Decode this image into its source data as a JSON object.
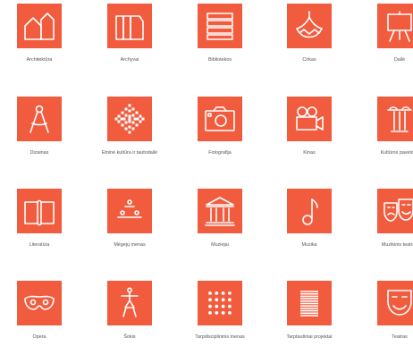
{
  "accent": "#f15c3f",
  "tiles": [
    {
      "label": "Architektūra",
      "icon": "architecture-icon"
    },
    {
      "label": "Archyvai",
      "icon": "archives-icon"
    },
    {
      "label": "Bibliotekos",
      "icon": "books-icon"
    },
    {
      "label": "Cirkas",
      "icon": "circus-tent-icon"
    },
    {
      "label": "Dailė",
      "icon": "easel-icon"
    },
    {
      "label": "Dizainas",
      "icon": "compass-icon"
    },
    {
      "label": "Etninė kultūra ir tautodailė",
      "icon": "folk-ornament-icon"
    },
    {
      "label": "Fotografija",
      "icon": "camera-icon"
    },
    {
      "label": "Kinas",
      "icon": "film-camera-icon"
    },
    {
      "label": "Kultūros paveldas",
      "icon": "column-icon"
    },
    {
      "label": "Literatūra",
      "icon": "open-book-icon"
    },
    {
      "label": "Mėgėjų menas",
      "icon": "amateur-stage-icon"
    },
    {
      "label": "Muziejai",
      "icon": "museum-icon"
    },
    {
      "label": "Muzika",
      "icon": "music-note-icon"
    },
    {
      "label": "Muzikinis teatras",
      "icon": "theatre-masks-icon"
    },
    {
      "label": "Opera",
      "icon": "opera-mask-icon"
    },
    {
      "label": "Šokis",
      "icon": "dancer-icon"
    },
    {
      "label": "Tarpdisciplininis menas",
      "icon": "dot-grid-icon"
    },
    {
      "label": "Tarptautiniai projektai",
      "icon": "lines-icon"
    },
    {
      "label": "Teatras",
      "icon": "theatre-mask-icon"
    }
  ]
}
